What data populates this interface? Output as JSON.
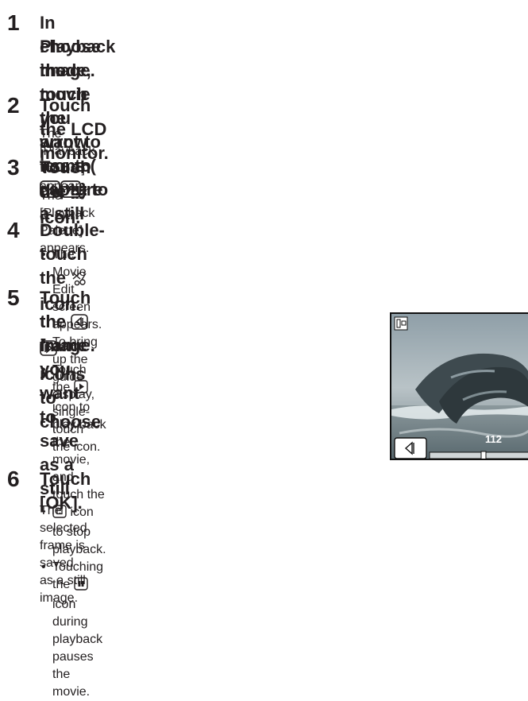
{
  "steps": [
    {
      "number": "1",
      "heading_pre": "In Playback mode, touch the arrow icons (",
      "heading_post": ") to",
      "heading_l2": "choose the movie you want to use to capture a still",
      "heading_l3": "image."
    },
    {
      "number": "2",
      "heading": "Touch the LCD monitor.",
      "body": "The [Playback Toolbar] appears."
    },
    {
      "number": "3",
      "heading_pre": "Touch the ",
      "heading_post": " icon.",
      "body": "The [Playback Palette] appears."
    },
    {
      "number": "4",
      "heading_pre": "Double-touch the ",
      "heading_post": " icon.",
      "bullets": [
        "The Movie Edit screen appears.",
        "To bring up the guide display, single-touch the icon."
      ]
    },
    {
      "number": "5",
      "heading_l1_pre": "Touch the ",
      "heading_l1_post": " icons to choose",
      "heading_l2": "the frame you want to save as a still",
      "heading_l3": "image.",
      "bullet1_pre": "Touch the ",
      "bullet1_mid": " icon to play back the movie,",
      "bullet1_l2_pre": "and touch the ",
      "bullet1_l2_post": " icon to stop playback.",
      "bullet2_pre": "Touching the ",
      "bullet2_post": " icon during playback",
      "bullet2_l2": "pauses the movie."
    },
    {
      "number": "6",
      "heading": "Touch [OK].",
      "body": "The selected frame is saved as a still image."
    }
  ],
  "screen": {
    "frame_counter": "112"
  },
  "icons": {
    "arrows": [
      "double-arrow-left-icon",
      "double-arrow-right-icon"
    ],
    "palette": "playback-palette-icon",
    "movie_edit": "movie-edit-scissors-icon",
    "frame_step": [
      "frame-back-icon",
      "frame-forward-icon"
    ],
    "play": "play-icon",
    "stop": "stop-icon",
    "pause": "pause-icon"
  }
}
